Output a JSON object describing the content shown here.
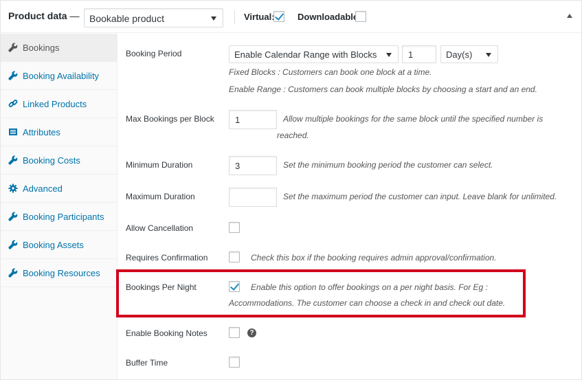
{
  "header": {
    "title": "Product data",
    "dash": "—",
    "product_type": "Bookable product",
    "virtual_label": "Virtual:",
    "virtual_checked": true,
    "downloadable_label": "Downloadable:",
    "downloadable_checked": false
  },
  "sidebar": {
    "items": [
      {
        "label": "Bookings",
        "icon": "wrench-icon",
        "active": true
      },
      {
        "label": "Booking Availability",
        "icon": "wrench-icon"
      },
      {
        "label": "Linked Products",
        "icon": "link-icon"
      },
      {
        "label": "Attributes",
        "icon": "table-icon"
      },
      {
        "label": "Booking Costs",
        "icon": "wrench-icon"
      },
      {
        "label": "Advanced",
        "icon": "gear-icon"
      },
      {
        "label": "Booking Participants",
        "icon": "wrench-icon"
      },
      {
        "label": "Booking Assets",
        "icon": "wrench-icon"
      },
      {
        "label": "Booking Resources",
        "icon": "wrench-icon"
      }
    ]
  },
  "form": {
    "booking_period": {
      "label": "Booking Period",
      "mode": "Enable Calendar Range with Blocks",
      "quantity": "1",
      "unit": "Day(s)",
      "desc1": "Fixed Blocks : Customers can book one block at a time.",
      "desc2": "Enable Range : Customers can book multiple blocks by choosing a start and an end."
    },
    "max_bookings": {
      "label": "Max Bookings per Block",
      "value": "1",
      "desc_line1": "Allow multiple bookings for the same block until the specified number is",
      "desc_line2": "reached."
    },
    "min_duration": {
      "label": "Minimum Duration",
      "value": "3",
      "desc": "Set the minimum booking period the customer can select."
    },
    "max_duration": {
      "label": "Maximum Duration",
      "value": "",
      "desc": "Set the maximum period the customer can input. Leave blank for unlimited."
    },
    "allow_cancellation": {
      "label": "Allow Cancellation",
      "checked": false
    },
    "requires_confirmation": {
      "label": "Requires Confirmation",
      "checked": false,
      "desc": "Check this box if the booking requires admin approval/confirmation."
    },
    "bookings_per_night": {
      "label": "Bookings Per Night",
      "checked": true,
      "desc_line1": "Enable this option to offer bookings on a per night basis. For Eg :",
      "desc_line2": "Accommodations. The customer can choose a check in and check out date."
    },
    "enable_booking_notes": {
      "label": "Enable Booking Notes",
      "checked": false,
      "help_glyph": "?"
    },
    "buffer_time": {
      "label": "Buffer Time",
      "checked": false
    }
  },
  "colors": {
    "link": "#0073aa",
    "highlight": "#d0021b",
    "check": "#1e8cbe"
  }
}
